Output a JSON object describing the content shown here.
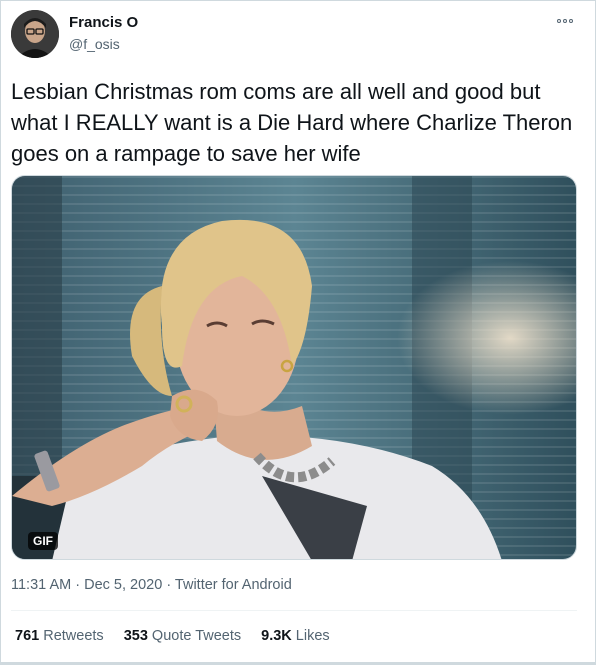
{
  "author": {
    "name": "Francis O",
    "handle": "@f_osis"
  },
  "more_icon": "more-horizontal-icon",
  "tweet": {
    "text": "Lesbian Christmas rom coms are all well and good but what I REALLY want is a Die Hard where Charlize Theron goes on a rampage to save her wife"
  },
  "media": {
    "badge": "GIF"
  },
  "meta": {
    "time": "11:31 AM",
    "separator": " · ",
    "date": "Dec 5, 2020",
    "source": "Twitter for Android"
  },
  "stats": {
    "retweets_count": "761",
    "retweets_label": "Retweets",
    "quotes_count": "353",
    "quotes_label": "Quote Tweets",
    "likes_count": "9.3K",
    "likes_label": "Likes"
  }
}
